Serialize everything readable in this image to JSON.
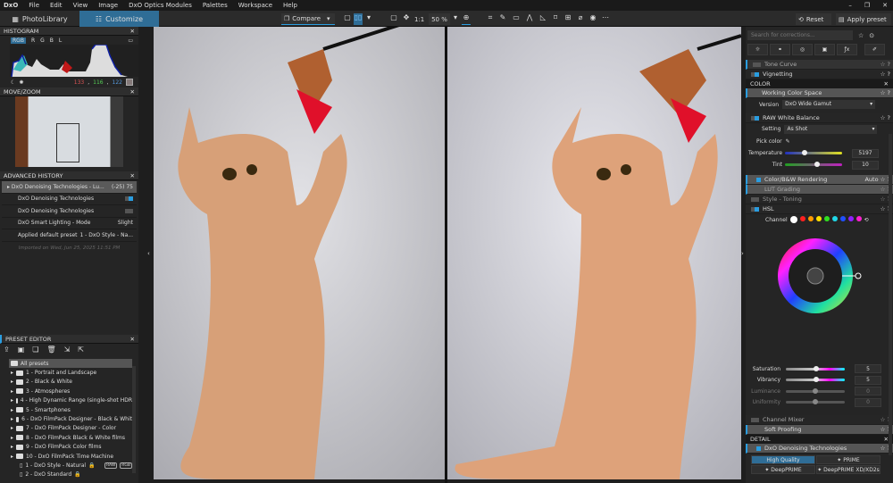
{
  "menu": {
    "logo": "DxO",
    "items": [
      "File",
      "Edit",
      "View",
      "Image",
      "DxO Optics Modules",
      "Palettes",
      "Workspace",
      "Help"
    ]
  },
  "toolbar": {
    "tabs": [
      "PhotoLibrary",
      "Customize"
    ],
    "compare": "Compare",
    "ratio": "1:1",
    "zoom": "50 %",
    "reset": "Reset",
    "apply_preset": "Apply preset"
  },
  "histogram": {
    "title": "HISTOGRAM",
    "channels": [
      "RGB",
      "R",
      "G",
      "B",
      "L"
    ],
    "r": "133",
    "g": "116",
    "b": "122"
  },
  "movezoom": {
    "title": "MOVE/ZOOM"
  },
  "history": {
    "title": "ADVANCED HISTORY",
    "rows": [
      {
        "label": "DxO Denoising Technologies - Lu...",
        "value": "(-25)  75"
      },
      {
        "label": "DxO Denoising Technologies",
        "value": ""
      },
      {
        "label": "DxO Denoising Technologies",
        "value": ""
      },
      {
        "label": "DxO Smart Lighting - Mode",
        "value": "Slight"
      },
      {
        "label": "Applied default preset",
        "value": "1 - DxO Style - Na..."
      }
    ],
    "footer": "Imported on Wed, Jun 25, 2025 11:51 PM"
  },
  "presets": {
    "title": "PRESET EDITOR",
    "root": "All presets",
    "folders": [
      "1 - Portrait and Landscape",
      "2 - Black & White",
      "3 - Atmospheres",
      "4 - High Dynamic Range (single-shot HDR",
      "5 - Smartphones",
      "6 - DxO FilmPack Designer - Black & Whit",
      "7 - DxO FilmPack Designer - Color",
      "8 - DxO FilmPack Black & White films",
      "9 - DxO FilmPack Color films",
      "10 - DxO FilmPack Time Machine"
    ],
    "items": [
      "1 - DxO Style - Natural",
      "2 - DxO Standard"
    ],
    "badges": [
      "RAW",
      "RGB"
    ]
  },
  "right": {
    "search_placeholder": "Search for corrections...",
    "tone_curve": "Tone Curve",
    "vignetting": "Vignetting",
    "color_section": "COLOR",
    "wcs": "Working Color Space",
    "version_label": "Version",
    "version_value": "DxO Wide Gamut",
    "rawwb": "RAW White Balance",
    "setting_label": "Setting",
    "setting_value": "As Shot",
    "pick_color": "Pick color",
    "temperature_label": "Temperature",
    "temperature_value": "5197",
    "temperature_pos": 0.3,
    "tint_label": "Tint",
    "tint_value": "10",
    "tint_pos": 0.52,
    "colorbw": "Color/B&W Rendering",
    "colorbw_value": "Auto",
    "lut": "LUT Grading",
    "style_toning": "Style - Toning",
    "hsl": "HSL",
    "channel_label": "Channel",
    "channel_colors": [
      "#ffffff",
      "#ff2020",
      "#ff9a00",
      "#ffe000",
      "#30e020",
      "#20d8e8",
      "#2050ff",
      "#9020ff",
      "#ff20d0"
    ],
    "sliders": [
      {
        "label": "Saturation",
        "value": "5",
        "pos": 0.52
      },
      {
        "label": "Vibrancy",
        "value": "5",
        "pos": 0.52
      },
      {
        "label": "Luminance",
        "value": "0",
        "pos": 0.5
      },
      {
        "label": "Uniformity",
        "value": "0",
        "pos": 0.5
      }
    ],
    "channel_mixer": "Channel Mixer",
    "soft_proofing": "Soft Proofing",
    "detail_section": "DETAIL",
    "denoise": "DxO Denoising Technologies",
    "modes": [
      "High Quality",
      "PRIME",
      "DeepPRIME",
      "DeepPRIME XD/XD2s"
    ]
  }
}
